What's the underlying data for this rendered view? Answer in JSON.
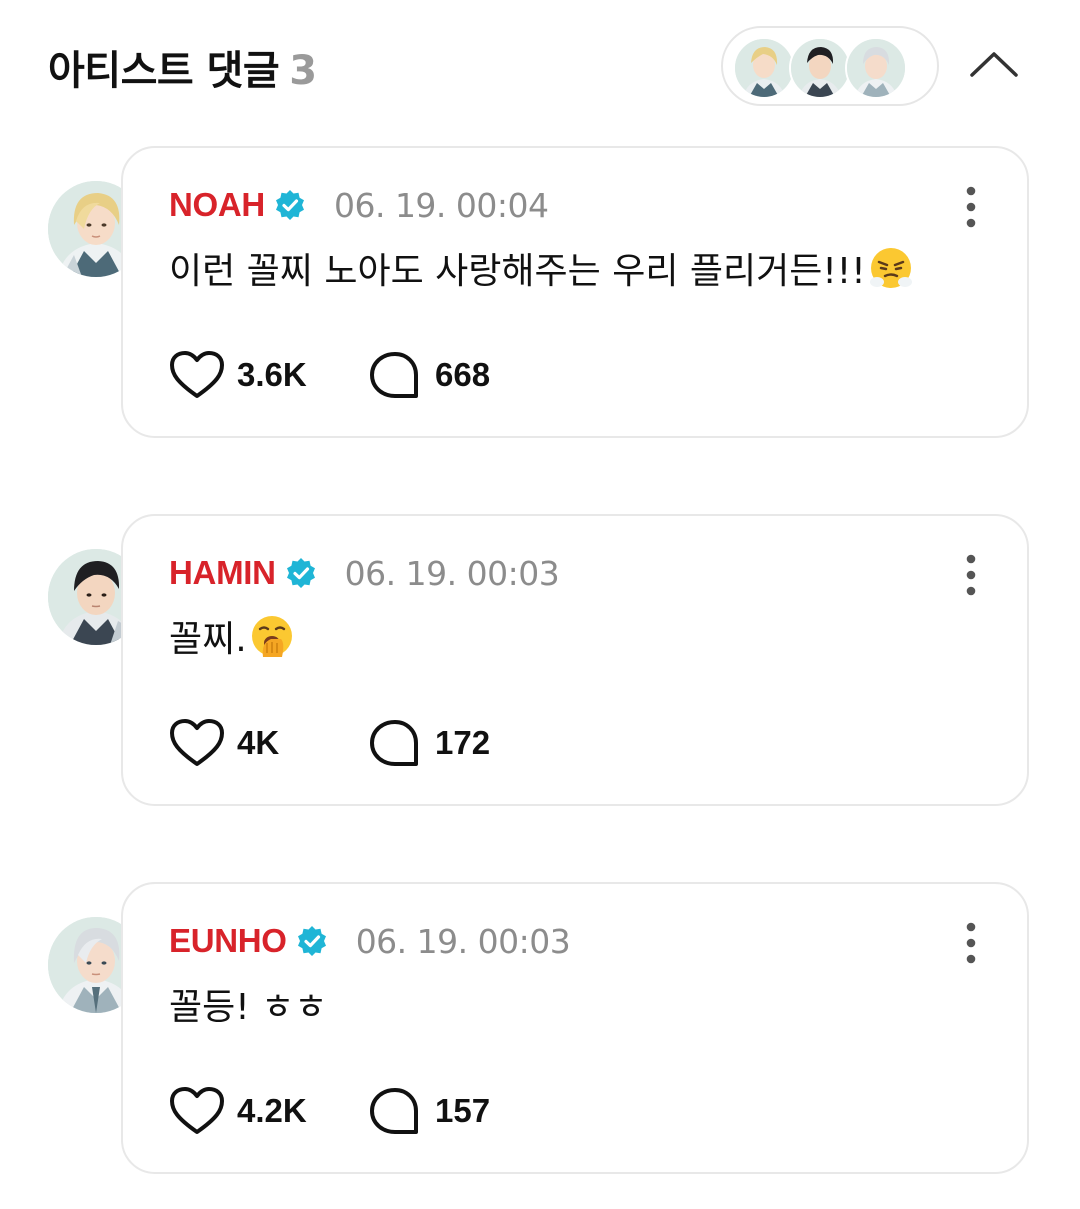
{
  "header": {
    "title": "아티스트 댓글",
    "count": "3",
    "avatars": [
      "noah",
      "hamin",
      "eunho"
    ]
  },
  "colors": {
    "name": "#d8232a",
    "verified": "#1fb5d6",
    "muted": "#8c8c8c",
    "border": "#e8e8e8"
  },
  "comments": [
    {
      "author": "NOAH",
      "time": "06. 19. 00:04",
      "text": "이런 꼴찌 노아도 사랑해주는 우리 플리거든!!!",
      "emoji": "steam-nose-emoji",
      "likes": "3.6K",
      "replies": "668"
    },
    {
      "author": "HAMIN",
      "time": "06. 19. 00:03",
      "text": "꼴찌.",
      "emoji": "yawn-emoji",
      "likes": "4K",
      "replies": "172"
    },
    {
      "author": "EUNHO",
      "time": "06. 19. 00:03",
      "text": "꼴등! ㅎㅎ",
      "emoji": "",
      "likes": "4.2K",
      "replies": "157"
    }
  ]
}
